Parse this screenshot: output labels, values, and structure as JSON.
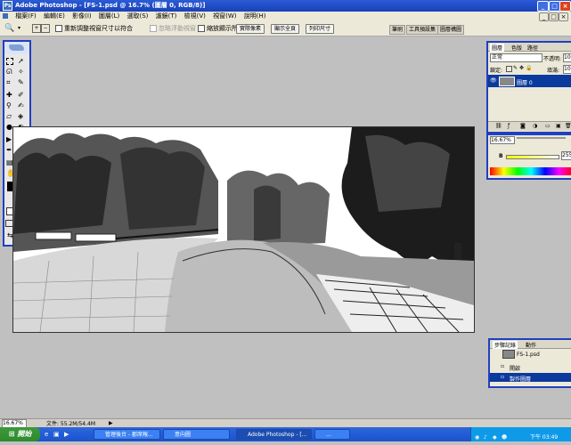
{
  "window": {
    "title": "Adobe Photoshop - [FS-1.psd @ 16.7% (圖層 0, RGB/8)]",
    "app_icon": "Ps"
  },
  "menu": [
    "檔案(F)",
    "編輯(E)",
    "影像(I)",
    "圖層(L)",
    "選取(S)",
    "濾鏡(T)",
    "檢視(V)",
    "視窗(W)",
    "說明(H)"
  ],
  "options": {
    "resize_label": "重新調整視窗尺寸以符合",
    "ignore_palettes": "忽略浮動視窗",
    "zoom_all": "縮放顯示所有的視窗",
    "actual_pixels": "實際像素",
    "fit_screen": "顯示全頁",
    "print_size": "列印尺寸"
  },
  "palette_tabs": [
    "筆刷",
    "工具預設集",
    "圖層構圖"
  ],
  "layers_panel": {
    "tabs": [
      "圖層",
      "色版",
      "路徑"
    ],
    "blend_mode": "正常",
    "opacity_label": "不透明:",
    "opacity_value": "100",
    "lock_label": "鎖定:",
    "fill_label": "填滿:",
    "fill_value": "100",
    "layer_name": "圖層 0"
  },
  "color_panel": {
    "zoom_value": "16.67%",
    "b_label": "B",
    "b_value": "255"
  },
  "history_panel": {
    "tabs": [
      "步驟記錄",
      "動作"
    ],
    "snapshot": "FS-1.psd",
    "items": [
      "開啟",
      "製作圖層"
    ]
  },
  "status": {
    "zoom": "16.67%",
    "doc_size": "文件: 55.2M/54.4M"
  },
  "taskbar": {
    "start": "開始",
    "tasks": [
      "管理後台 - 郡席報...",
      "意向圖",
      "Adobe Photoshop - [...",
      "..."
    ],
    "clock": "下午 03:49"
  },
  "colors": {
    "title_bar": "#1941b8",
    "panel_border": "#2040c0",
    "taskbar": "#245edb",
    "start_button": "#2d8a2d"
  }
}
